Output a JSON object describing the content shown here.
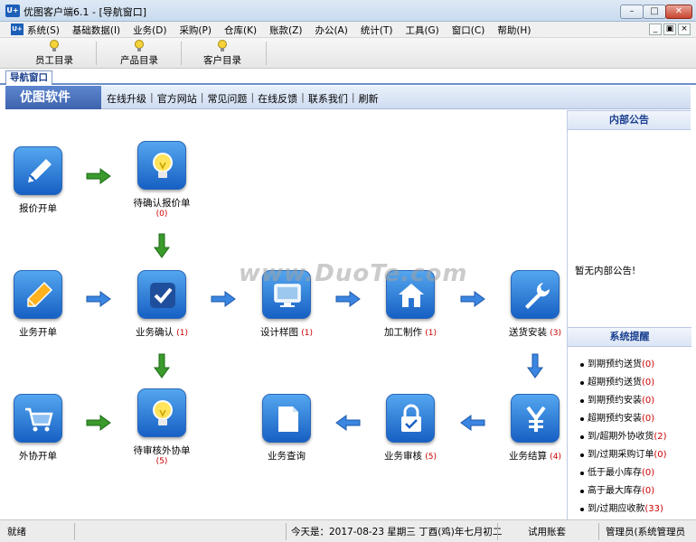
{
  "window": {
    "title": "优图客户端6.1 - [导航窗口]",
    "app_badge": "U+"
  },
  "menubar": {
    "items": [
      "系统(S)",
      "基础数据(I)",
      "业务(D)",
      "采购(P)",
      "仓库(K)",
      "账款(Z)",
      "办公(A)",
      "统计(T)",
      "工具(G)",
      "窗口(C)",
      "帮助(H)"
    ]
  },
  "toolbar": {
    "buttons": [
      "员工目录",
      "产品目录",
      "客户目录"
    ]
  },
  "tabs": {
    "active": "导航窗口"
  },
  "brandbar": {
    "brand": "优图软件",
    "links": [
      "在线升级",
      "官方网站",
      "常见问题",
      "在线反馈",
      "联系我们",
      "刷新"
    ]
  },
  "flow": {
    "nodes": [
      {
        "key": "quote",
        "label": "报价开单",
        "count": ""
      },
      {
        "key": "pending_quote",
        "label": "待确认报价单",
        "count": "(0)"
      },
      {
        "key": "order",
        "label": "业务开单",
        "count": ""
      },
      {
        "key": "confirm",
        "label": "业务确认",
        "count": "(1)"
      },
      {
        "key": "design",
        "label": "设计样图",
        "count": "(1)"
      },
      {
        "key": "produce",
        "label": "加工制作",
        "count": "(1)"
      },
      {
        "key": "install",
        "label": "送货安装",
        "count": "(3)"
      },
      {
        "key": "outsource",
        "label": "外协开单",
        "count": ""
      },
      {
        "key": "pending_outsource",
        "label": "待审核外协单",
        "count": "(5)"
      },
      {
        "key": "query",
        "label": "业务查询",
        "count": ""
      },
      {
        "key": "audit",
        "label": "业务审核",
        "count": "(5)"
      },
      {
        "key": "settle",
        "label": "业务结算",
        "count": "(4)"
      }
    ]
  },
  "watermark": "www.DuoTe.com",
  "panel": {
    "notice_title": "内部公告",
    "notice_text": "暂无内部公告!",
    "remind_title": "系统提醒",
    "reminders": [
      {
        "label": "到期预约送货",
        "count": "(0)"
      },
      {
        "label": "超期预约送货",
        "count": "(0)"
      },
      {
        "label": "到期预约安装",
        "count": "(0)"
      },
      {
        "label": "超期预约安装",
        "count": "(0)"
      },
      {
        "label": "到/超期外协收货",
        "count": "(2)"
      },
      {
        "label": "到/过期采购订单",
        "count": "(0)"
      },
      {
        "label": "低于最小库存",
        "count": "(0)"
      },
      {
        "label": "高于最大库存",
        "count": "(0)"
      },
      {
        "label": "到/过期应收款",
        "count": "(33)"
      }
    ]
  },
  "statusbar": {
    "state": "就绪",
    "date": "今天是：2017-08-23 星期三 丁酉(鸡)年七月初二",
    "account": "试用账套",
    "user": "管理员(系统管理员"
  }
}
